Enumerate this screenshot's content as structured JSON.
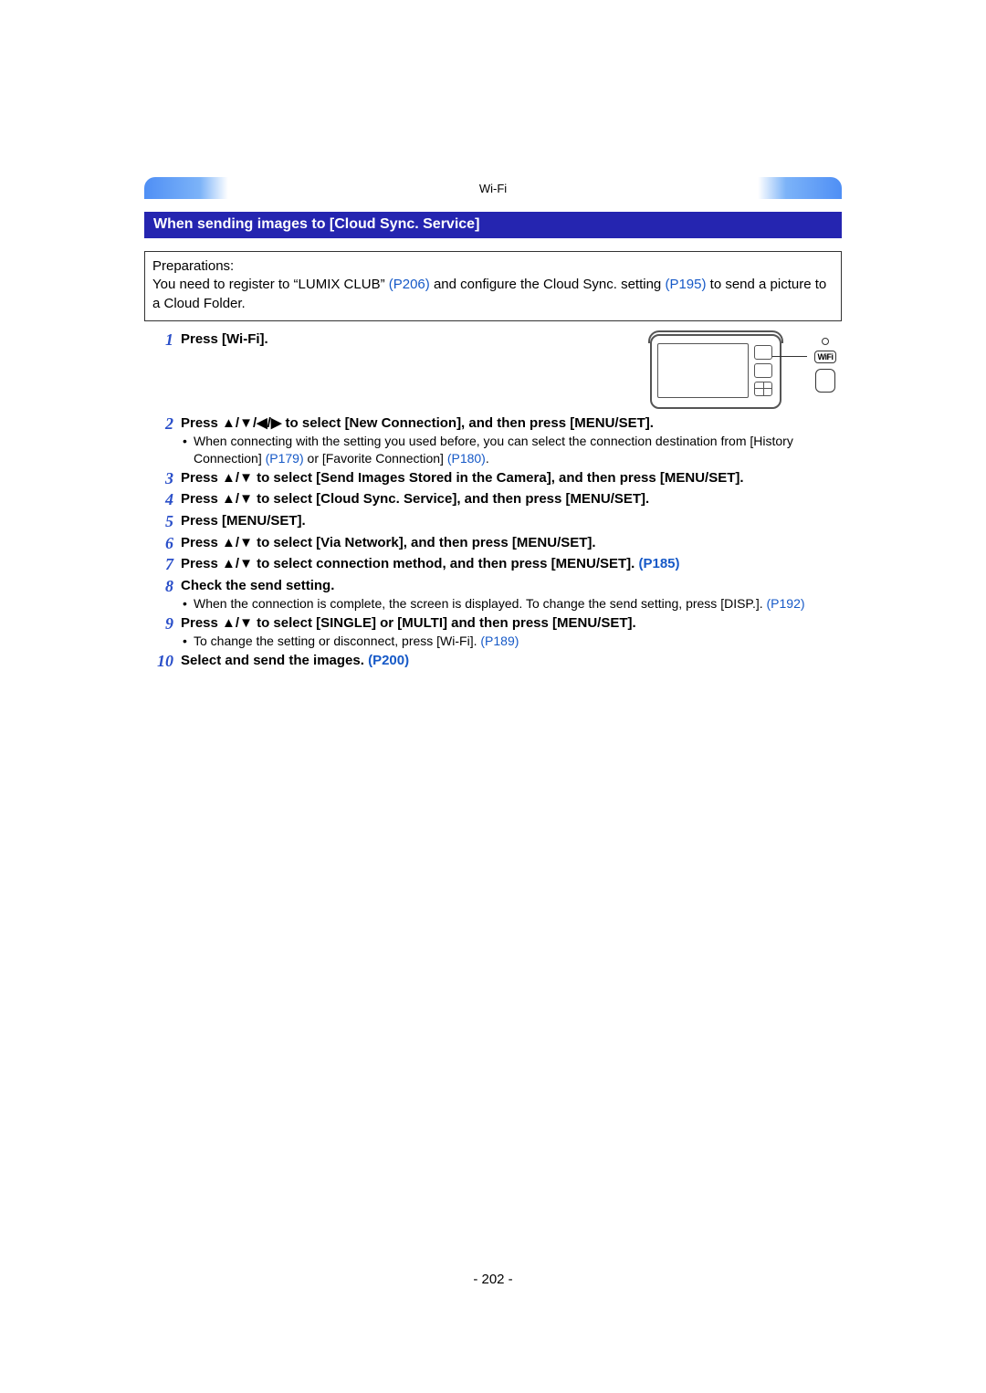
{
  "header": {
    "category": "Wi-Fi"
  },
  "section": {
    "title": "When sending images to [Cloud Sync. Service]"
  },
  "prep": {
    "label": "Preparations:",
    "line_a": "You need to register to “LUMIX CLUB” ",
    "ref1": "(P206)",
    "line_b": " and configure the Cloud Sync. setting ",
    "ref2": "(P195)",
    "line_c": " to send a picture to a Cloud Folder."
  },
  "wifi_label": "WiFi",
  "arrows": {
    "up": "▲",
    "down": "▼",
    "left": "◀",
    "right": "▶"
  },
  "steps": [
    {
      "n": "1",
      "bold": "Press [Wi-Fi]."
    },
    {
      "n": "2",
      "bold_a": "Press ",
      "bold_b": " to select [New Connection], and then press [MENU/SET].",
      "sub_a": "When connecting with the setting you used before, you can select the connection destination from [History Connection] ",
      "sub_ref1": "(P179)",
      "sub_mid": " or [Favorite Connection] ",
      "sub_ref2": "(P180)",
      "sub_end": "."
    },
    {
      "n": "3",
      "bold_a": "Press ",
      "bold_b": " to select [Send Images Stored in the Camera], and then press [MENU/SET]."
    },
    {
      "n": "4",
      "bold_a": "Press ",
      "bold_b": " to select [Cloud Sync. Service], and then press [MENU/SET]."
    },
    {
      "n": "5",
      "bold": "Press [MENU/SET]."
    },
    {
      "n": "6",
      "bold_a": "Press ",
      "bold_b": " to select [Via Network], and then press [MENU/SET]."
    },
    {
      "n": "7",
      "bold_a": "Press ",
      "bold_b": " to select connection method, and then press [MENU/SET]. ",
      "ref": "(P185)"
    },
    {
      "n": "8",
      "bold": "Check the send setting.",
      "sub_a": "When the connection is complete, the screen is displayed. To change the send setting, press [DISP.]. ",
      "sub_ref1": "(P192)"
    },
    {
      "n": "9",
      "bold_a": "Press ",
      "bold_b": " to select [SINGLE] or [MULTI] and then press [MENU/SET].",
      "sub_a": "To change the setting or disconnect, press [Wi-Fi]. ",
      "sub_ref1": "(P189)"
    },
    {
      "n": "10",
      "bold": "Select and send the images. ",
      "ref": "(P200)"
    }
  ],
  "page_number": "- 202 -"
}
